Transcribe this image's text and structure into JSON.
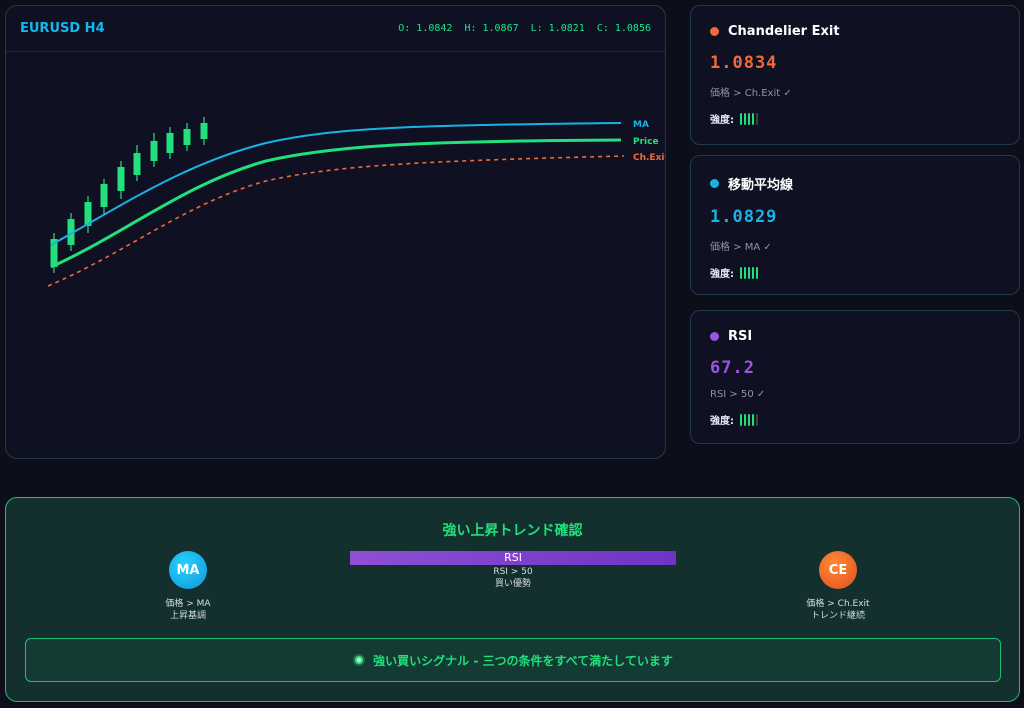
{
  "chart": {
    "title": "EURUSD H4",
    "ohlc": {
      "o": "O: 1.0842",
      "h": "H: 1.0867",
      "l: ": "",
      "l": "L: 1.0821",
      "c": "C: 1.0856"
    },
    "line_labels": {
      "ma": "MA",
      "price": "Price",
      "ch_exit": "Ch.Exit"
    },
    "colors": {
      "ma": "#19b2e6",
      "price": "#1fe07a",
      "ch_exit": "#f06a3a",
      "candle": "#22e07e"
    }
  },
  "indicators": [
    {
      "name": "Chandelier Exit",
      "value": "1.0834",
      "condition": "価格 > Ch.Exit ✓",
      "strength_label": "強度:",
      "strength": 4,
      "color": "#f06a3a"
    },
    {
      "name": "移動平均線",
      "value": "1.0829",
      "condition": "価格 > MA ✓",
      "strength_label": "強度:",
      "strength": 5,
      "color": "#19b2e6"
    },
    {
      "name": "RSI",
      "value": "67.2",
      "condition": "RSI > 50 ✓",
      "strength_label": "強度:",
      "strength": 4,
      "color": "#9c55e0"
    }
  ],
  "summary": {
    "title": "強い上昇トレンド確認",
    "ma_badge": {
      "label": "MA",
      "line1": "価格 > MA",
      "line2": "上昇基調"
    },
    "rsi": {
      "label": "RSI",
      "line1": "RSI > 50",
      "line2": "買い優勢"
    },
    "ce_badge": {
      "label": "CE",
      "line1": "価格 > Ch.Exit",
      "line2": "トレンド継続"
    },
    "signal": "強い買いシグナル - 三つの条件をすべて満たしています"
  }
}
